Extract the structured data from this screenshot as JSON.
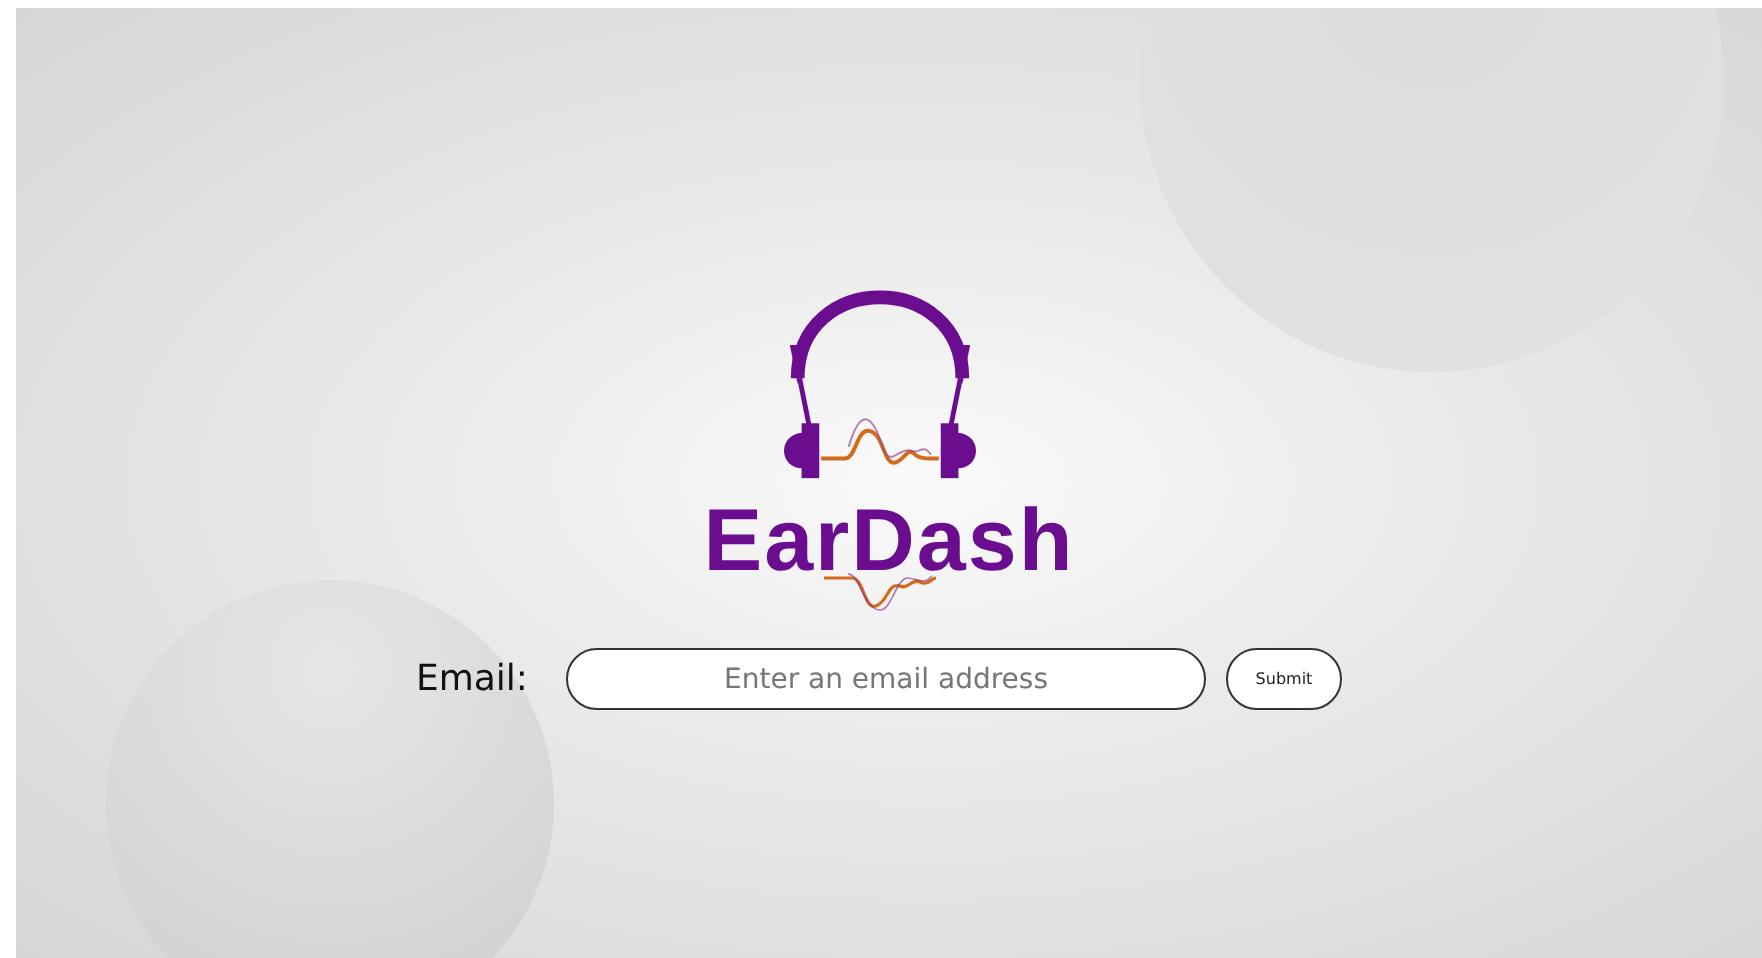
{
  "logo": {
    "text": "EarDash"
  },
  "form": {
    "label": "Email:",
    "email_field": {
      "placeholder": "Enter an email address"
    },
    "submit_button": "Submit"
  }
}
